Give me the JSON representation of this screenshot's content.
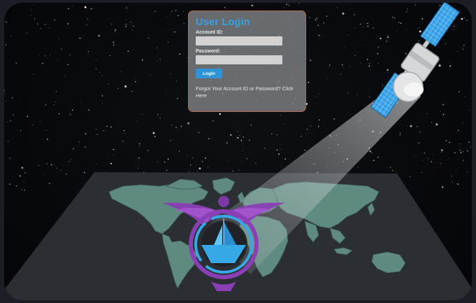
{
  "login": {
    "title": "User Login",
    "account_label": "Account ID:",
    "account_value": "",
    "password_label": "Password:",
    "password_value": "",
    "button_label": "Login",
    "forgot_text": "Forgot Your Account ID or Password? Click Here"
  },
  "colors": {
    "accent": "#3aa0e0",
    "panel_border": "#b36a4f",
    "map_land": "#5f8a7f",
    "emblem_purple": "#8a3fb5",
    "emblem_blue": "#37a8e6"
  },
  "icons": [
    "satellite-icon",
    "world-map",
    "navy-emblem-icon"
  ]
}
